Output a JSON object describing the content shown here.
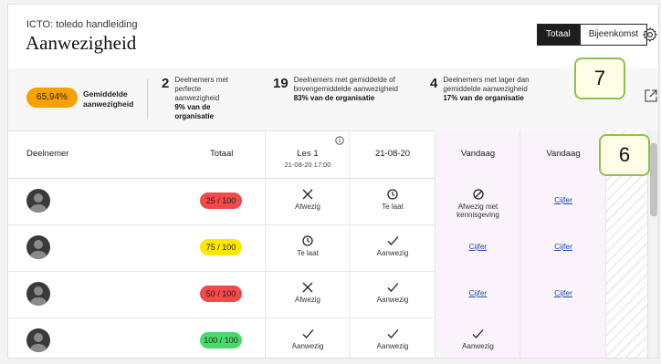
{
  "header": {
    "course": "ICTO: toledo handleiding",
    "title": "Aanwezigheid",
    "tabs": {
      "active": "Totaal",
      "inactive": "Bijeenkomst"
    }
  },
  "stats": {
    "average_pct": "65,94%",
    "average_label": "Gemiddelde aanwezigheid",
    "perfect": {
      "num": "2",
      "text": "Deelnemers met perfecte aanwezigheid",
      "pct": "9% van de organisatie"
    },
    "above": {
      "num": "19",
      "text": "Deelnemers met gemiddelde of bovengemiddelde aanwezigheid",
      "pct": "83% van de organisatie"
    },
    "below": {
      "num": "4",
      "text": "Deelnemers met lager dan gemiddelde aanwezigheid",
      "pct": "17% van de organisatie"
    }
  },
  "table": {
    "headers": {
      "participant": "Deelnemer",
      "total": "Totaal",
      "les1_title": "Les 1",
      "les1_date": "21-08-20 17:00",
      "col2": "21-08-20",
      "vandaag1": "Vandaag",
      "vandaag2": "Vandaag"
    },
    "rows": [
      {
        "score": "25 / 100",
        "score_color": "#f24a4a",
        "c1": "Afwezig",
        "c1_icon": "x-icon",
        "c2": "Te laat",
        "c2_icon": "clock-icon",
        "c3": "Afwezig met kennisgeving",
        "c3_icon": "excused-icon",
        "c4": "Cijfer"
      },
      {
        "score": "75 / 100",
        "score_color": "#ffe600",
        "c1": "Te laat",
        "c1_icon": "clock-icon",
        "c2": "Aanwezig",
        "c2_icon": "check-icon",
        "c3": "Cijfer",
        "c3_icon": "",
        "c4": "Cijfer"
      },
      {
        "score": "50 / 100",
        "score_color": "#f24a4a",
        "c1": "Afwezig",
        "c1_icon": "x-icon",
        "c2": "Aanwezig",
        "c2_icon": "check-icon",
        "c3": "Cijfer",
        "c3_icon": "",
        "c4": "Cijfer"
      },
      {
        "score": "100 / 100",
        "score_color": "#4cd96b",
        "c1": "Aanwezig",
        "c1_icon": "check-icon",
        "c2": "Aanwezig",
        "c2_icon": "check-icon",
        "c3": "Aanwezig",
        "c3_icon": "check-icon",
        "c4": ""
      }
    ]
  },
  "callouts": {
    "seven": "7",
    "six": "6"
  },
  "colors": {
    "accent_orange": "#f7a000",
    "vandaag_bg": "#faf3fb",
    "callout_border": "#8bc34a"
  }
}
